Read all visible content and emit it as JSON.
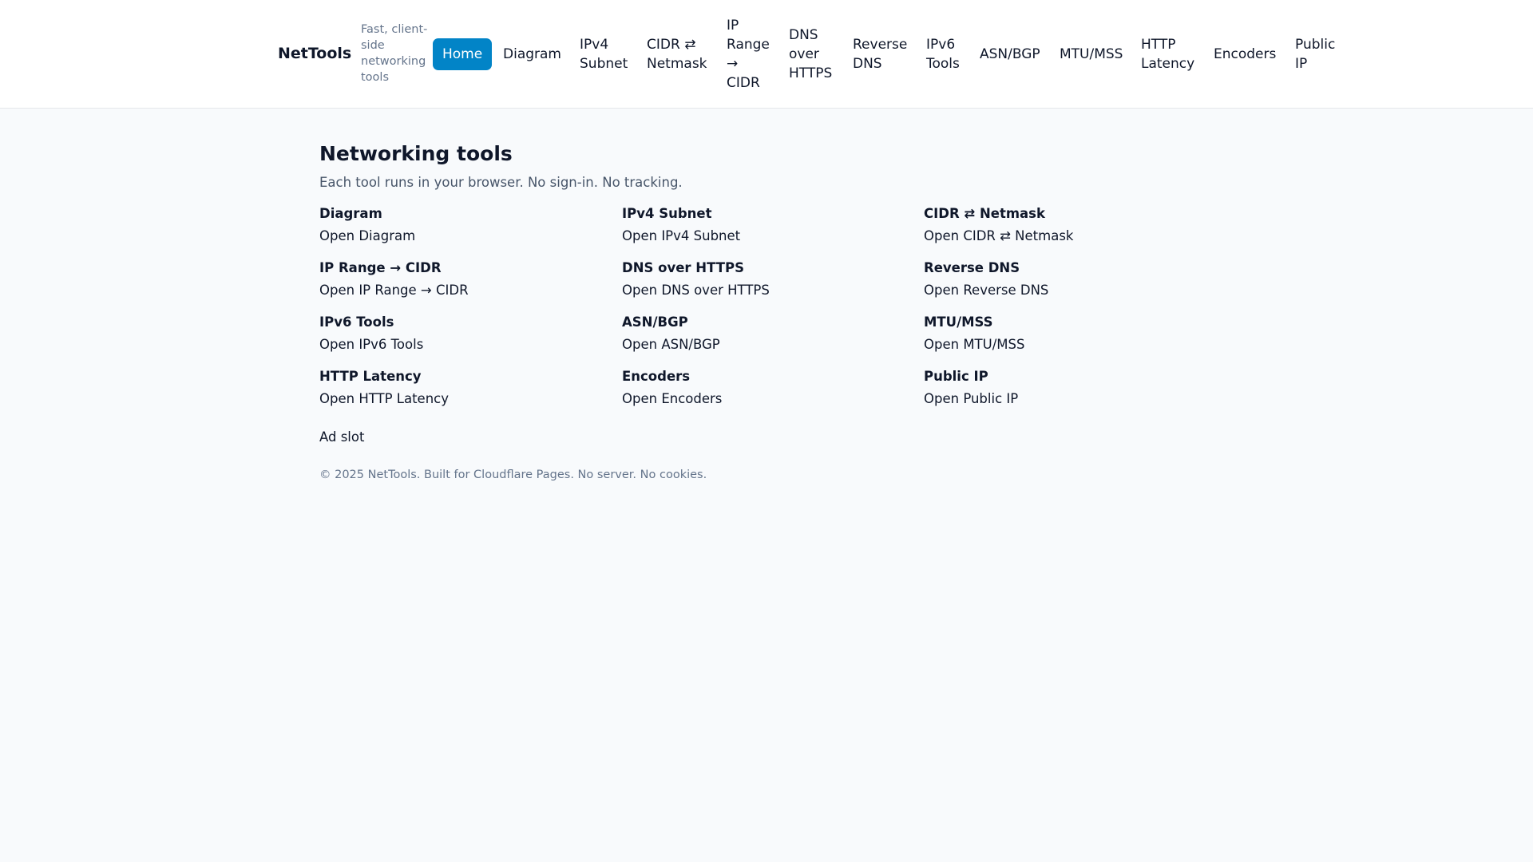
{
  "header": {
    "brand": "NetTools",
    "tagline": "Fast, client-side networking tools",
    "nav": [
      {
        "label": "Home",
        "active": true
      },
      {
        "label": "Diagram"
      },
      {
        "label": "IPv4 Subnet"
      },
      {
        "label": "CIDR ⇄ Netmask"
      },
      {
        "label": "IP Range → CIDR"
      },
      {
        "label": "DNS over HTTPS"
      },
      {
        "label": "Reverse DNS"
      },
      {
        "label": "IPv6 Tools"
      },
      {
        "label": "ASN/BGP"
      },
      {
        "label": "MTU/MSS"
      },
      {
        "label": "HTTP Latency"
      },
      {
        "label": "Encoders"
      },
      {
        "label": "Public IP"
      }
    ]
  },
  "main": {
    "title": "Networking tools",
    "subtitle": "Each tool runs in your browser. No sign-in. No tracking.",
    "tools": [
      {
        "title": "Diagram",
        "link": "Open Diagram"
      },
      {
        "title": "IPv4 Subnet",
        "link": "Open IPv4 Subnet"
      },
      {
        "title": "CIDR ⇄ Netmask",
        "link": "Open CIDR ⇄ Netmask"
      },
      {
        "title": "IP Range → CIDR",
        "link": "Open IP Range → CIDR"
      },
      {
        "title": "DNS over HTTPS",
        "link": "Open DNS over HTTPS"
      },
      {
        "title": "Reverse DNS",
        "link": "Open Reverse DNS"
      },
      {
        "title": "IPv6 Tools",
        "link": "Open IPv6 Tools"
      },
      {
        "title": "ASN/BGP",
        "link": "Open ASN/BGP"
      },
      {
        "title": "MTU/MSS",
        "link": "Open MTU/MSS"
      },
      {
        "title": "HTTP Latency",
        "link": "Open HTTP Latency"
      },
      {
        "title": "Encoders",
        "link": "Open Encoders"
      },
      {
        "title": "Public IP",
        "link": "Open Public IP"
      }
    ],
    "ad_slot": "Ad slot"
  },
  "footer": {
    "text": "© 2025 NetTools. Built for Cloudflare Pages. No server. No cookies."
  },
  "colors": {
    "accent": "#0284c7",
    "background": "#f8fafc",
    "header_bg": "#ffffff",
    "muted_text": "#64748b"
  }
}
